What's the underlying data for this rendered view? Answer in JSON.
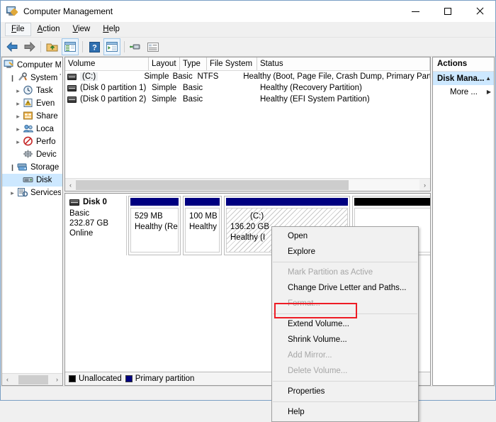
{
  "window": {
    "title": "Computer Management",
    "icon": "computer-management-icon",
    "buttons": {
      "minimize": "–",
      "maximize": "□",
      "close": "✕"
    }
  },
  "menubar": {
    "items": [
      {
        "label": "File",
        "accel": "F"
      },
      {
        "label": "Action",
        "accel": "A"
      },
      {
        "label": "View",
        "accel": "V"
      },
      {
        "label": "Help",
        "accel": "H"
      }
    ]
  },
  "toolbar": {
    "items": [
      {
        "name": "back-icon",
        "label": "Back"
      },
      {
        "name": "forward-icon",
        "label": "Forward"
      },
      {
        "name": "up-folder-icon",
        "label": "Up One Level"
      },
      {
        "name": "show-hide-console-tree-icon",
        "label": "Show/Hide Console Tree"
      },
      {
        "name": "help-icon",
        "label": "Help"
      },
      {
        "name": "show-hide-action-pane-icon",
        "label": "Show/Hide Action Pane"
      },
      {
        "name": "connect-icon",
        "label": "Connect to another computer"
      },
      {
        "name": "properties-list-icon",
        "label": "Properties"
      }
    ]
  },
  "sidebar": {
    "items": [
      {
        "label": "Computer M",
        "level": 0,
        "chevron": "",
        "icon": "computer-icon",
        "selected": false
      },
      {
        "label": "System T",
        "level": 1,
        "chevron": "v",
        "icon": "system-tools-icon",
        "selected": false
      },
      {
        "label": "Task",
        "level": 2,
        "chevron": ">",
        "icon": "task-scheduler-icon",
        "selected": false
      },
      {
        "label": "Even",
        "level": 2,
        "chevron": ">",
        "icon": "event-viewer-icon",
        "selected": false
      },
      {
        "label": "Share",
        "level": 2,
        "chevron": ">",
        "icon": "shared-folders-icon",
        "selected": false
      },
      {
        "label": "Loca",
        "level": 2,
        "chevron": ">",
        "icon": "local-users-groups-icon",
        "selected": false
      },
      {
        "label": "Perfo",
        "level": 2,
        "chevron": ">",
        "icon": "performance-icon",
        "selected": false
      },
      {
        "label": "Devic",
        "level": 2,
        "chevron": "",
        "icon": "device-manager-icon",
        "selected": false
      },
      {
        "label": "Storage",
        "level": 1,
        "chevron": "v",
        "icon": "storage-icon",
        "selected": false
      },
      {
        "label": "Disk",
        "level": 2,
        "chevron": "",
        "icon": "disk-management-icon",
        "selected": true
      },
      {
        "label": "Services",
        "level": 1,
        "chevron": ">",
        "icon": "services-applications-icon",
        "selected": false
      }
    ],
    "scroll": {
      "left_arrow": "‹",
      "right_arrow": "›"
    }
  },
  "volume_list": {
    "columns": [
      "Volume",
      "Layout",
      "Type",
      "File System",
      "Status"
    ],
    "rows": [
      {
        "volume": "(C:)",
        "layout": "Simple",
        "type": "Basic",
        "file_system": "NTFS",
        "status": "Healthy (Boot, Page File, Crash Dump, Primary Partition)",
        "selected": true
      },
      {
        "volume": "(Disk 0 partition 1)",
        "layout": "Simple",
        "type": "Basic",
        "file_system": "",
        "status": "Healthy (Recovery Partition)",
        "selected": false
      },
      {
        "volume": "(Disk 0 partition 2)",
        "layout": "Simple",
        "type": "Basic",
        "file_system": "",
        "status": "Healthy (EFI System Partition)",
        "selected": false
      }
    ],
    "scroll": {
      "left_arrow": "‹",
      "right_arrow": "›"
    }
  },
  "disk_view": {
    "disk": {
      "name": "Disk 0",
      "type": "Basic",
      "capacity": "232.87 GB",
      "state": "Online"
    },
    "partitions": [
      {
        "label": "",
        "size": "529 MB",
        "status": "Healthy (Reco",
        "kind": "primary",
        "selected": false
      },
      {
        "label": "",
        "size": "100 MB",
        "status": "Healthy (",
        "kind": "primary",
        "selected": false
      },
      {
        "label": "(C:)",
        "size": "136.20 GB",
        "status": "Healthy (I",
        "kind": "primary",
        "selected": true
      },
      {
        "label": "",
        "size": "",
        "status": "",
        "kind": "unallocated",
        "selected": false
      }
    ],
    "legend": [
      {
        "label": "Unallocated",
        "color": "#000000",
        "kind": "unalloc"
      },
      {
        "label": "Primary partition",
        "color": "#000080",
        "kind": "primary"
      }
    ]
  },
  "actions_pane": {
    "title": "Actions",
    "items": [
      {
        "label": "Disk Mana...",
        "selected": true,
        "marker": "▲",
        "indent": false
      },
      {
        "label": "More ...",
        "selected": false,
        "marker": "▶",
        "indent": true
      }
    ]
  },
  "context_menu": {
    "items": [
      {
        "label": "Open",
        "disabled": false,
        "separator_after": false
      },
      {
        "label": "Explore",
        "disabled": false,
        "separator_after": true
      },
      {
        "label": "Mark Partition as Active",
        "disabled": true,
        "separator_after": false
      },
      {
        "label": "Change Drive Letter and Paths...",
        "disabled": false,
        "separator_after": false
      },
      {
        "label": "Format...",
        "disabled": true,
        "separator_after": true
      },
      {
        "label": "Extend Volume...",
        "disabled": false,
        "separator_after": false,
        "highlighted": true
      },
      {
        "label": "Shrink Volume...",
        "disabled": false,
        "separator_after": false
      },
      {
        "label": "Add Mirror...",
        "disabled": true,
        "separator_after": false
      },
      {
        "label": "Delete Volume...",
        "disabled": true,
        "separator_after": true
      },
      {
        "label": "Properties",
        "disabled": false,
        "separator_after": true
      },
      {
        "label": "Help",
        "disabled": false,
        "separator_after": false
      }
    ],
    "highlight_color": "#ee1c25"
  }
}
